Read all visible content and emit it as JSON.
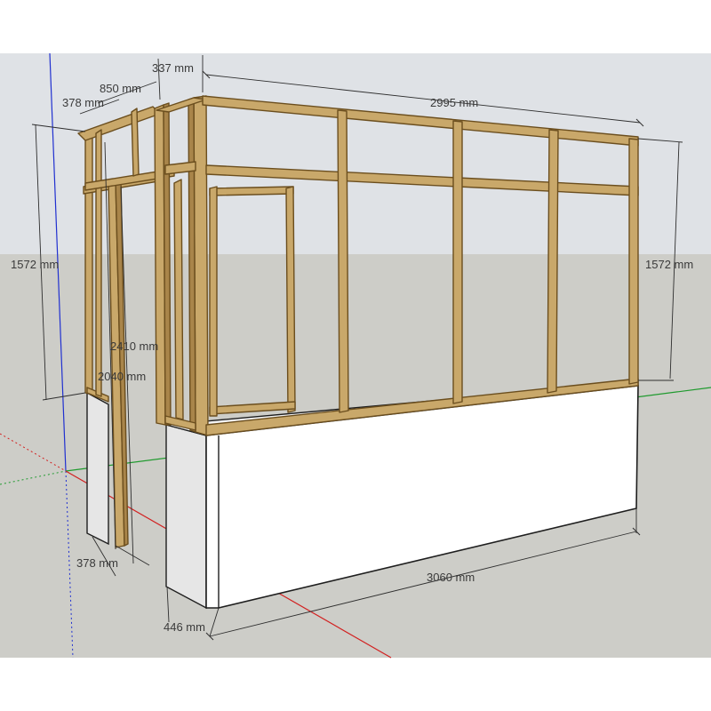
{
  "scene": {
    "colors": {
      "sky": "#dfe2e6",
      "ground": "#cdcdc8",
      "wood": "#c9a86a",
      "wood_edge": "#6b4e1e",
      "wall": "#ffffff",
      "axis_red": "#d22020",
      "axis_green": "#1f9a2e",
      "axis_blue": "#2030d0"
    }
  },
  "dimensions": {
    "top_337": "337 mm",
    "top_850": "850 mm",
    "top_378": "378 mm",
    "top_2995": "2995 mm",
    "left_1572": "1572 mm",
    "right_1572": "1572 mm",
    "mid_2410": "2410 mm",
    "mid_2040": "2040 mm",
    "bottom_378": "378 mm",
    "bottom_3060": "3060 mm",
    "bottom_446": "446 mm"
  }
}
